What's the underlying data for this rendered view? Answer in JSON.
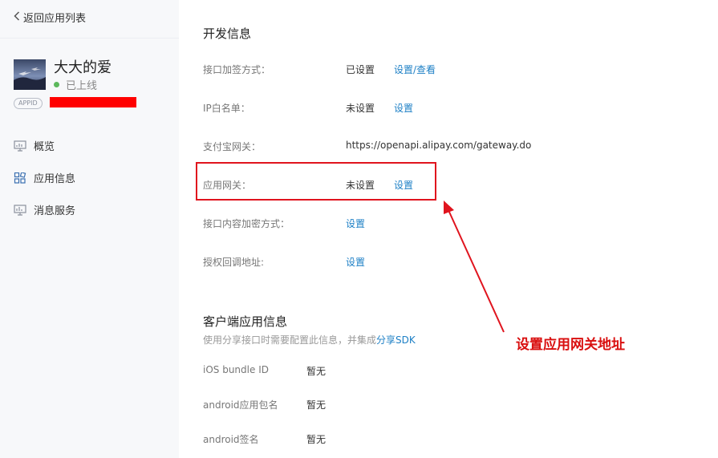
{
  "sidebar": {
    "back_label": "返回应用列表",
    "app_name": "大大的爱",
    "app_status": "已上线",
    "appid_tag": "APPID",
    "nav": [
      {
        "label": "概览",
        "icon": "monitor-icon"
      },
      {
        "label": "应用信息",
        "icon": "grid-icon"
      },
      {
        "label": "消息服务",
        "icon": "chart-icon"
      }
    ]
  },
  "dev_info": {
    "title": "开发信息",
    "rows": [
      {
        "label": "接口加签方式：",
        "value": "已设置",
        "action": "设置/查看"
      },
      {
        "label": "IP白名单：",
        "value": "未设置",
        "action": "设置"
      },
      {
        "label": "支付宝网关：",
        "value": "https://openapi.alipay.com/gateway.do"
      },
      {
        "label": "应用网关：",
        "value": "未设置",
        "action": "设置"
      },
      {
        "label": "接口内容加密方式：",
        "action": "设置"
      },
      {
        "label": "授权回调地址:",
        "action": "设置"
      }
    ]
  },
  "client_info": {
    "title": "客户端应用信息",
    "hint_prefix": "使用分享接口时需要配置此信息，并集成",
    "hint_link": "分享SDK",
    "rows": [
      {
        "label": "iOS bundle ID",
        "value": "暂无"
      },
      {
        "label": "android应用包名",
        "value": "暂无"
      },
      {
        "label": "android签名",
        "value": "暂无"
      }
    ]
  },
  "annotation": {
    "text": "设置应用网关地址",
    "color": "#d90f0f"
  },
  "colors": {
    "link": "#1e80c6",
    "status_online": "#5cb85c",
    "highlight": "#e0141e"
  }
}
